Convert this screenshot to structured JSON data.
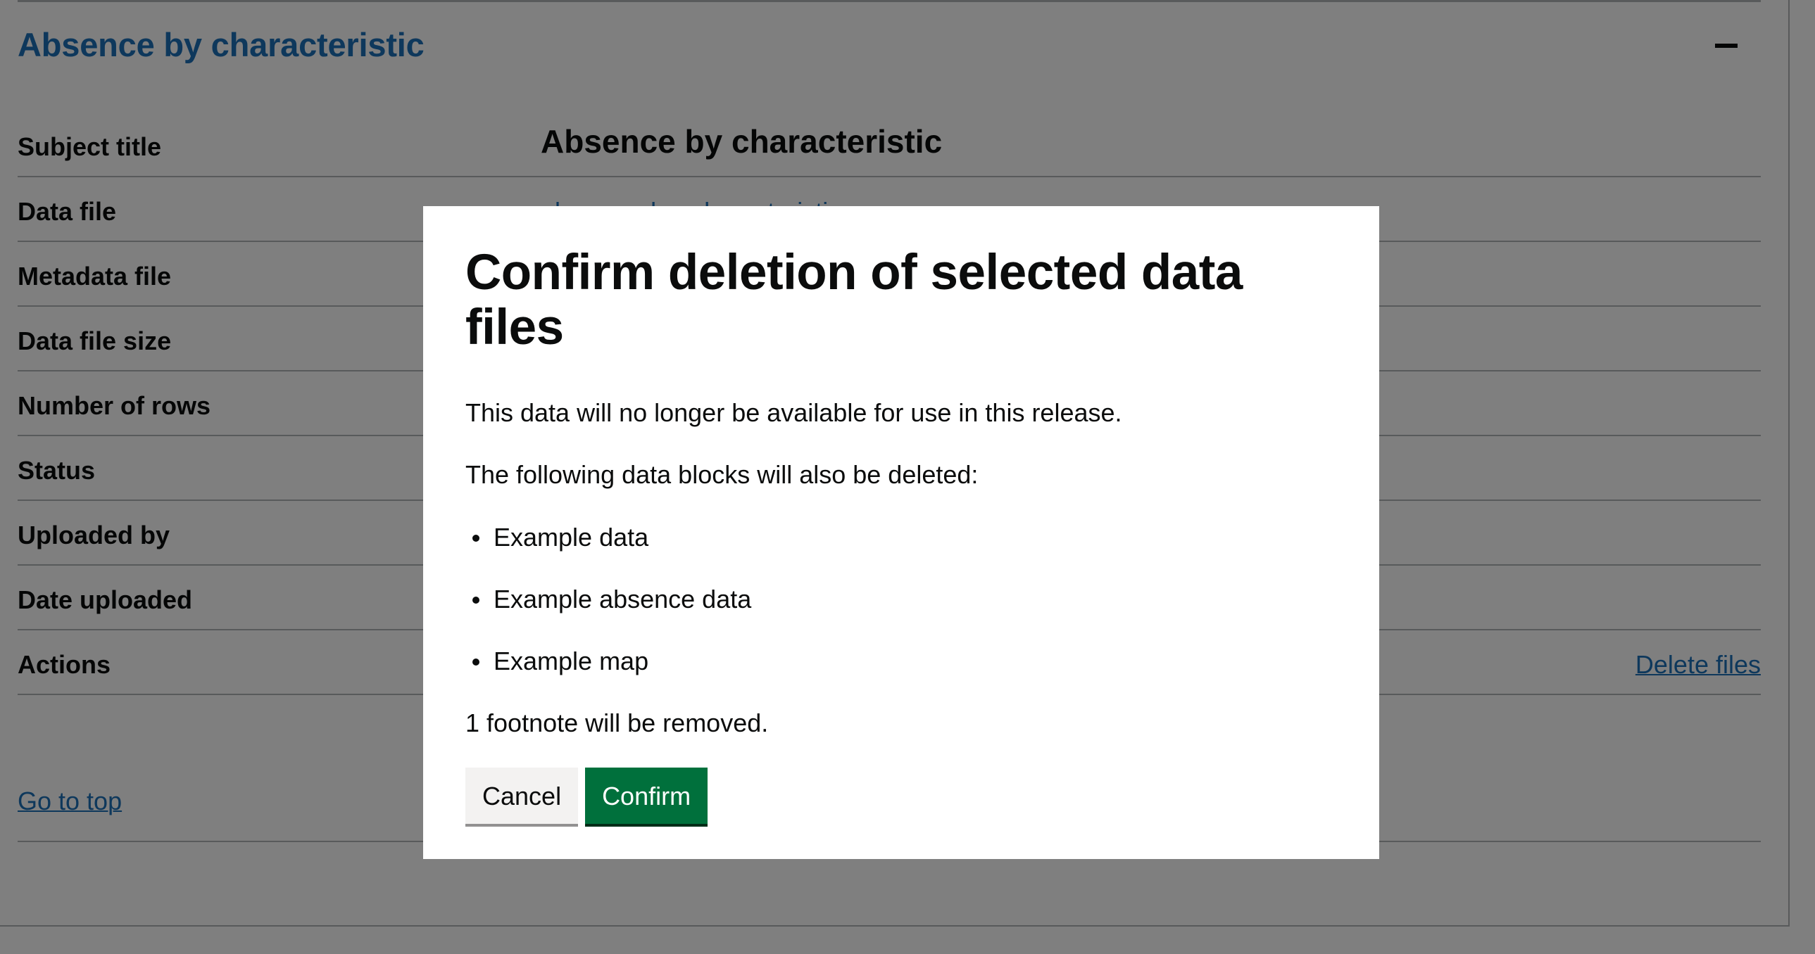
{
  "section": {
    "heading": "Absence by characteristic"
  },
  "summary": {
    "rows": [
      {
        "key": "Subject title",
        "value": "Absence by characteristic"
      },
      {
        "key": "Data file",
        "value": "absence_by_characteristic.csv"
      },
      {
        "key": "Metadata file",
        "value": ""
      },
      {
        "key": "Data file size",
        "value": ""
      },
      {
        "key": "Number of rows",
        "value": ""
      },
      {
        "key": "Status",
        "value": ""
      },
      {
        "key": "Uploaded by",
        "value": ""
      },
      {
        "key": "Date uploaded",
        "value": ""
      },
      {
        "key": "Actions",
        "value": "",
        "action": "Delete files"
      }
    ]
  },
  "links": {
    "go_to_top": "Go to top"
  },
  "modal": {
    "title": "Confirm deletion of selected data files",
    "intro": "This data will no longer be available for use in this release.",
    "blocks_heading": "The following data blocks will also be deleted:",
    "blocks": [
      "Example data",
      "Example absence data",
      "Example map"
    ],
    "footnote_text": "1 footnote will be removed.",
    "cancel_label": "Cancel",
    "confirm_label": "Confirm"
  },
  "colors": {
    "link": "#1d70b8",
    "primary_button": "#00703c",
    "secondary_button": "#f3f2f1",
    "overlay": "rgba(0,0,0,0.5)"
  }
}
